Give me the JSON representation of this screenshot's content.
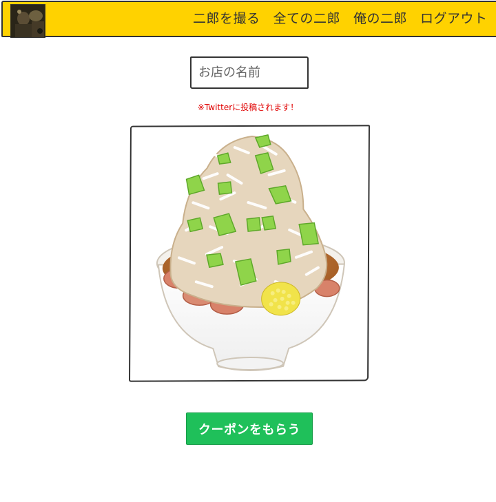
{
  "header": {
    "background_color": "#ffd200",
    "avatar_icon": "user-avatar-photo",
    "nav": [
      {
        "label": "二郎を撮る"
      },
      {
        "label": "全ての二郎"
      },
      {
        "label": "俺の二郎"
      },
      {
        "label": "ログアウト"
      }
    ]
  },
  "form": {
    "shop_name_placeholder": "お店の名前",
    "shop_name_value": "",
    "notice": "※Twitterに投稿されます！",
    "notice_color": "#e00000",
    "image_icon": "ramen-bowl-image"
  },
  "coupon_button": {
    "label": "クーポンをもらう",
    "color": "#1fc05a"
  }
}
